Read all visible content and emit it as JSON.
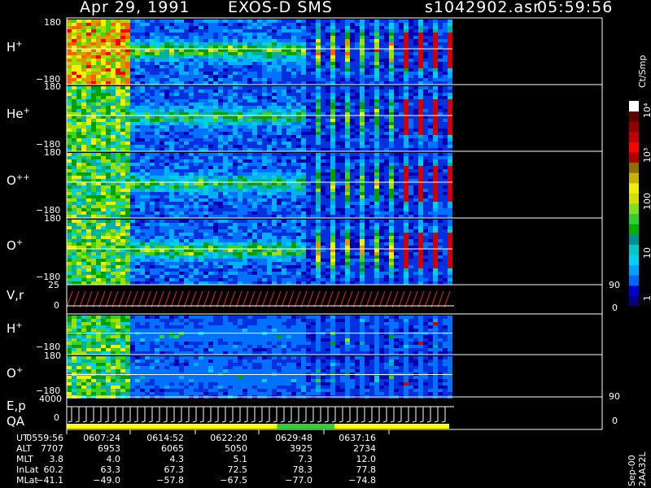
{
  "header": {
    "date": "Apr 29, 1991",
    "instrument": "EXOS-D SMS",
    "file": "s1042902.asr",
    "time": "05:59:56"
  },
  "panels": [
    {
      "label": "H",
      "sup": "+",
      "top_tick": "180",
      "bottom_tick": "−180"
    },
    {
      "label": "He",
      "sup": "+",
      "top_tick": "180",
      "bottom_tick": "−180"
    },
    {
      "label": "O",
      "sup": "++",
      "top_tick": "180",
      "bottom_tick": "−180"
    },
    {
      "label": "O",
      "sup": "+",
      "top_tick": "180",
      "bottom_tick": "−180"
    },
    {
      "label": "V,r",
      "sup": "",
      "top_tick": "25",
      "bottom_tick": "0",
      "right_top": "90",
      "right_bottom": "0"
    },
    {
      "label": "H",
      "sup": "+",
      "top_tick": "180",
      "bottom_tick": "−180"
    },
    {
      "label": "O",
      "sup": "+",
      "top_tick": "180",
      "bottom_tick": "−180"
    },
    {
      "label": "E,p",
      "sup": "",
      "label2": "QA",
      "top_tick": "4000",
      "bottom_tick": "0",
      "right_top": "90",
      "right_bottom": "0"
    }
  ],
  "colorbar": {
    "unit_label": "Ct/Smp",
    "tick_labels": [
      "1",
      "10",
      "100",
      "10³",
      "10⁴"
    ],
    "colors": [
      "#000080",
      "#0000cd",
      "#0066ff",
      "#00a0ff",
      "#00d0ff",
      "#00c8c8",
      "#009090",
      "#00b000",
      "#30d030",
      "#80e020",
      "#d0e000",
      "#f0f000",
      "#c8b400",
      "#907000",
      "#b00000",
      "#ff0000",
      "#c00000",
      "#900000",
      "#600000",
      "#ffffff"
    ]
  },
  "footer_info": {
    "rows": [
      {
        "label": "UT",
        "values": [
          "0559:56",
          "0607:24",
          "0614:52",
          "0622:20",
          "0629:48",
          "0637:16"
        ]
      },
      {
        "label": "ALT",
        "values": [
          "7707",
          "6953",
          "6065",
          "5050",
          "3925",
          "2734"
        ]
      },
      {
        "label": "MLT",
        "values": [
          "3.8",
          "4.0",
          "4.3",
          "5.1",
          "7.3",
          "12.0"
        ]
      },
      {
        "label": "InLat",
        "values": [
          "60.2",
          "63.3",
          "67.3",
          "72.5",
          "78.3",
          "77.8"
        ]
      },
      {
        "label": "MLat",
        "values": [
          "−41.1",
          "−49.0",
          "−57.8",
          "−67.5",
          "−77.0",
          "−74.8"
        ]
      }
    ]
  },
  "side_label": "Sep-00 2AA32L",
  "chart_data": {
    "type": "heatmap",
    "description_series": [
      "H+",
      "He+",
      "O++",
      "O+",
      "V,r",
      "H+",
      "O+",
      "E,p"
    ],
    "x_times": [
      "0559:56",
      "0607:24",
      "0614:52",
      "0622:20",
      "0629:48",
      "0637:16"
    ],
    "ylim_pitch": [
      -180,
      180
    ],
    "ylim_vr": [
      0,
      25
    ],
    "ylim_ep": [
      0,
      4000
    ],
    "color_scale": "log",
    "color_range": [
      1,
      10000
    ]
  }
}
